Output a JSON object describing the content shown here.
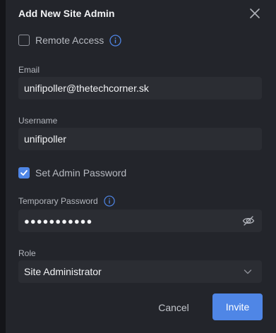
{
  "dialog": {
    "title": "Add New Site Admin",
    "close_icon": "close-icon"
  },
  "remote_access": {
    "label": "Remote Access",
    "checked": false,
    "info_icon": "info-icon"
  },
  "email": {
    "label": "Email",
    "value": "unifipoller@thetechcorner.sk"
  },
  "username": {
    "label": "Username",
    "value": "unifipoller"
  },
  "set_admin_password": {
    "label": "Set Admin Password",
    "checked": true
  },
  "temporary_password": {
    "label": "Temporary Password",
    "masked_value": "●●●●●●●●●●●",
    "info_icon": "info-icon",
    "visibility_icon": "eye-off-icon"
  },
  "role": {
    "label": "Role",
    "selected": "Site Administrator",
    "chevron_icon": "chevron-down-icon"
  },
  "actions": {
    "cancel_label": "Cancel",
    "invite_label": "Invite"
  },
  "colors": {
    "accent": "#4f86e6",
    "dialog_bg": "#23252b",
    "field_bg": "#2b2d33"
  }
}
